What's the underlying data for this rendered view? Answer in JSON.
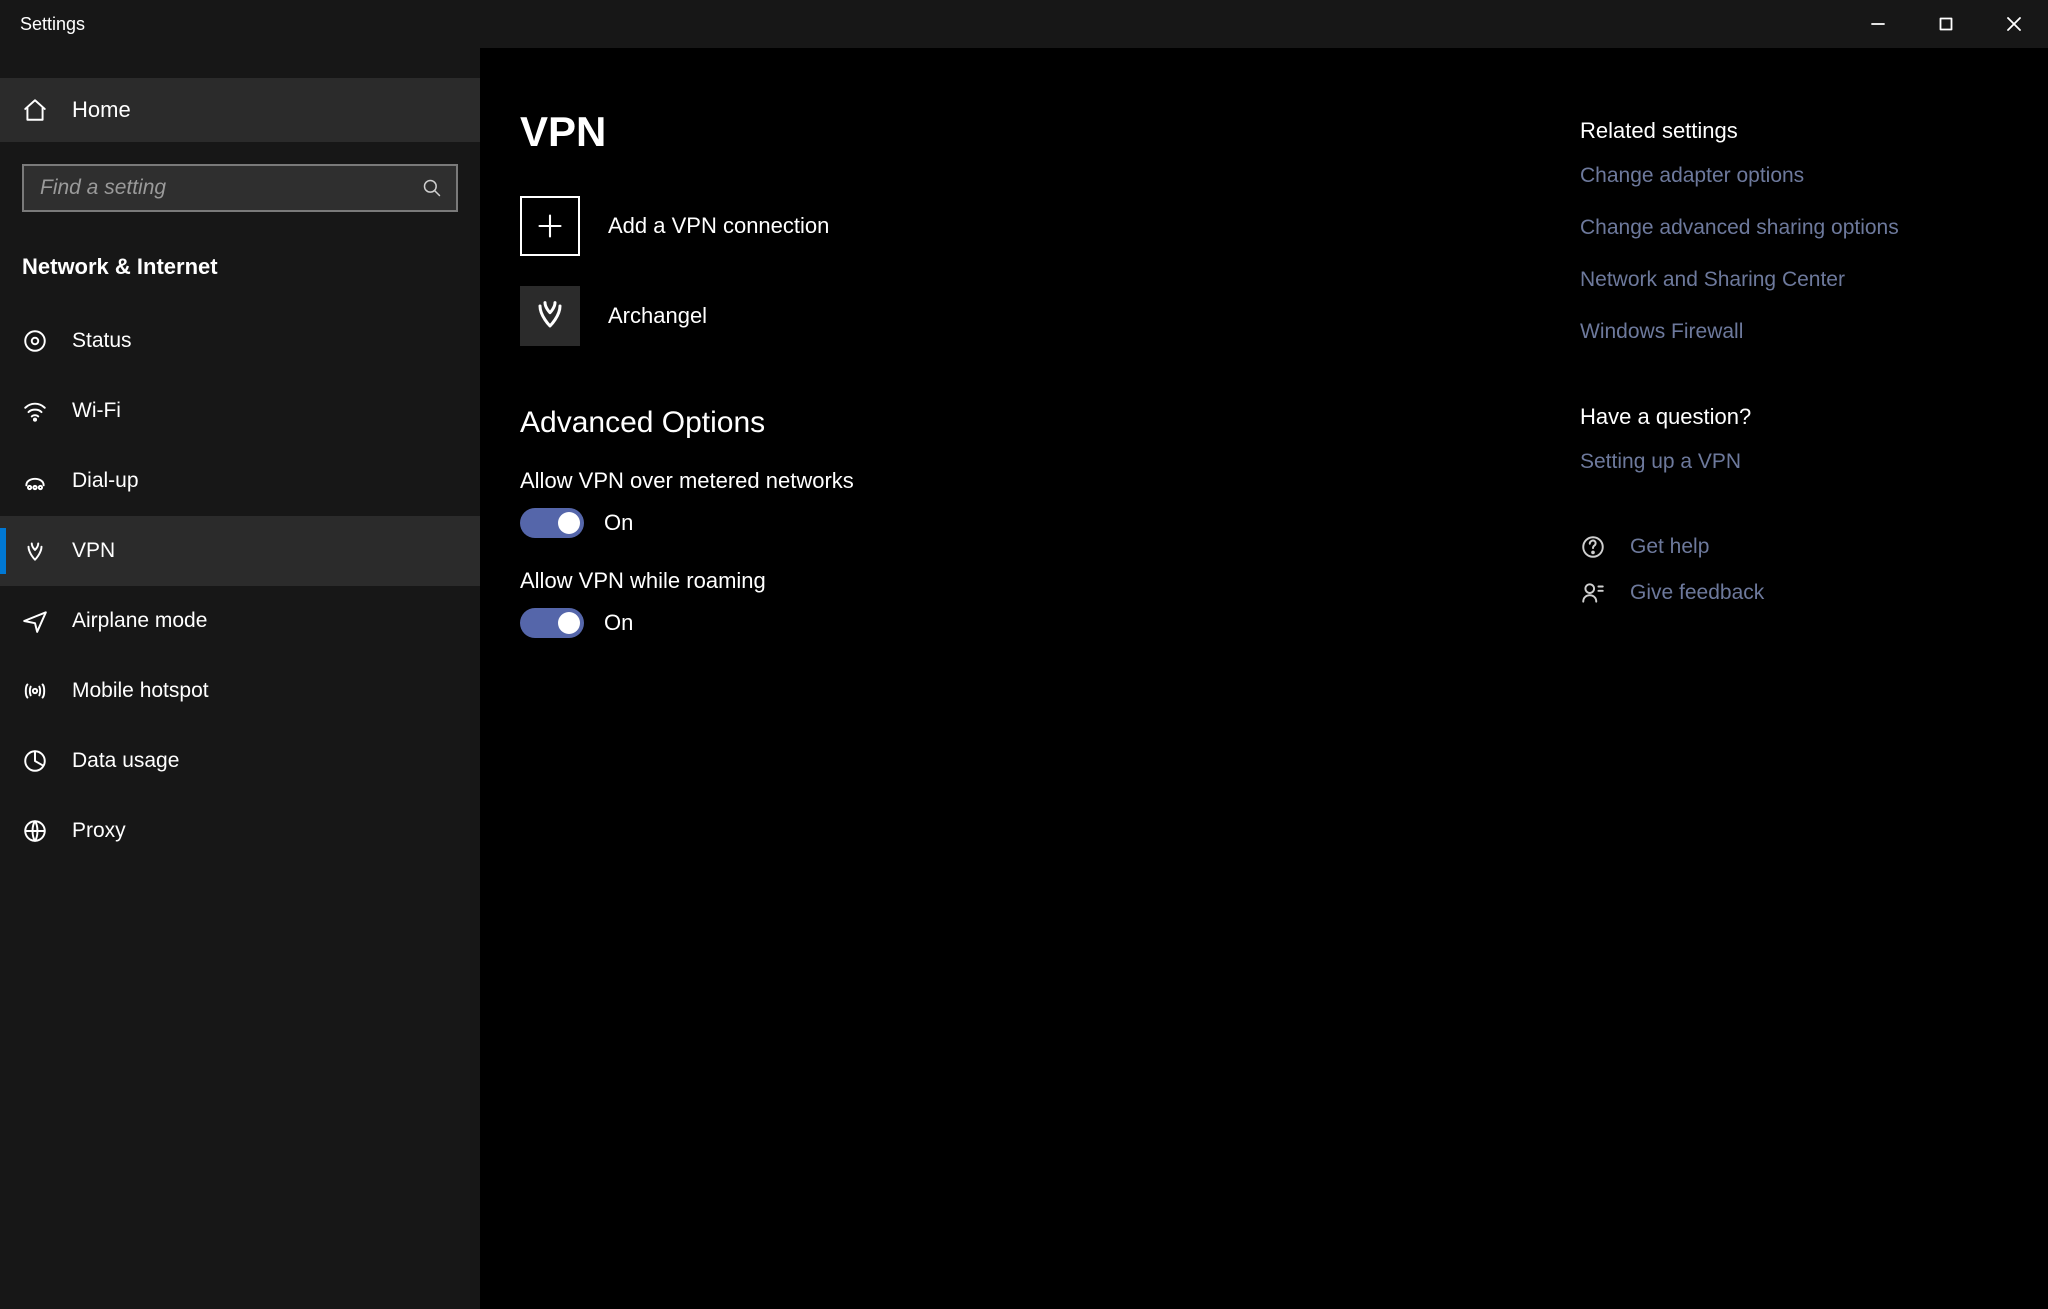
{
  "window": {
    "title": "Settings"
  },
  "sidebar": {
    "home": "Home",
    "search_placeholder": "Find a setting",
    "section": "Network & Internet",
    "items": [
      {
        "label": "Status"
      },
      {
        "label": "Wi-Fi"
      },
      {
        "label": "Dial-up"
      },
      {
        "label": "VPN"
      },
      {
        "label": "Airplane mode"
      },
      {
        "label": "Mobile hotspot"
      },
      {
        "label": "Data usage"
      },
      {
        "label": "Proxy"
      }
    ]
  },
  "main": {
    "title": "VPN",
    "add_label": "Add a VPN connection",
    "connections": [
      {
        "name": "Archangel"
      }
    ],
    "advanced_heading": "Advanced Options",
    "toggles": [
      {
        "label": "Allow VPN over metered networks",
        "state": "On"
      },
      {
        "label": "Allow VPN while roaming",
        "state": "On"
      }
    ]
  },
  "related": {
    "heading": "Related settings",
    "links": [
      "Change adapter options",
      "Change advanced sharing options",
      "Network and Sharing Center",
      "Windows Firewall"
    ]
  },
  "question": {
    "heading": "Have a question?",
    "links": [
      "Setting up a VPN"
    ]
  },
  "help": {
    "get_help": "Get help",
    "give_feedback": "Give feedback"
  }
}
